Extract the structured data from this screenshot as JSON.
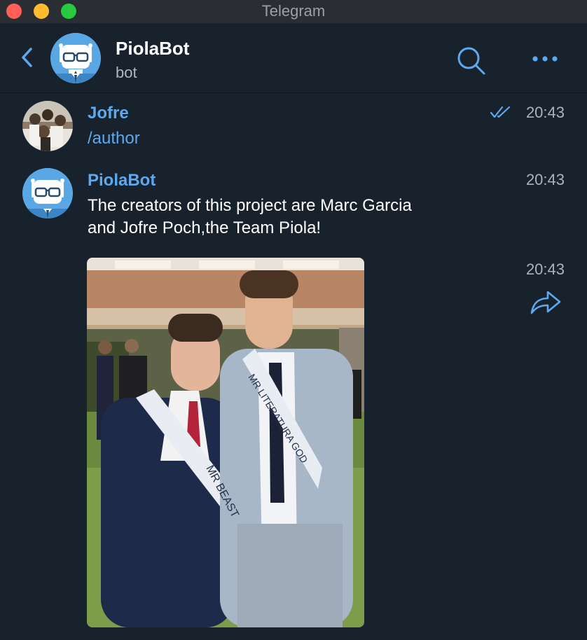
{
  "window": {
    "title": "Telegram"
  },
  "header": {
    "name": "PiolaBot",
    "status": "bot"
  },
  "messages": [
    {
      "sender": "Jofre",
      "text": "/author",
      "time": "20:43",
      "read": true
    },
    {
      "sender": "PiolaBot",
      "text_line1": "The creators of this project are Marc Garcia",
      "text_line2": "and Jofre Poch,the Team Piola!",
      "time": "20:43"
    },
    {
      "type": "photo",
      "time": "20:43",
      "sash_left": "MR BEAST",
      "sash_right": "MR LITERATURA GOD"
    }
  ],
  "icons": {
    "back": "chevron-left-icon",
    "search": "search-icon",
    "more": "more-icon",
    "read": "double-check-icon",
    "share": "share-icon"
  },
  "colors": {
    "background": "#18222d",
    "accent": "#5ea9ee",
    "bot_avatar": "#59a7e4",
    "text": "#ffffff",
    "muted": "#a9b3bc"
  }
}
